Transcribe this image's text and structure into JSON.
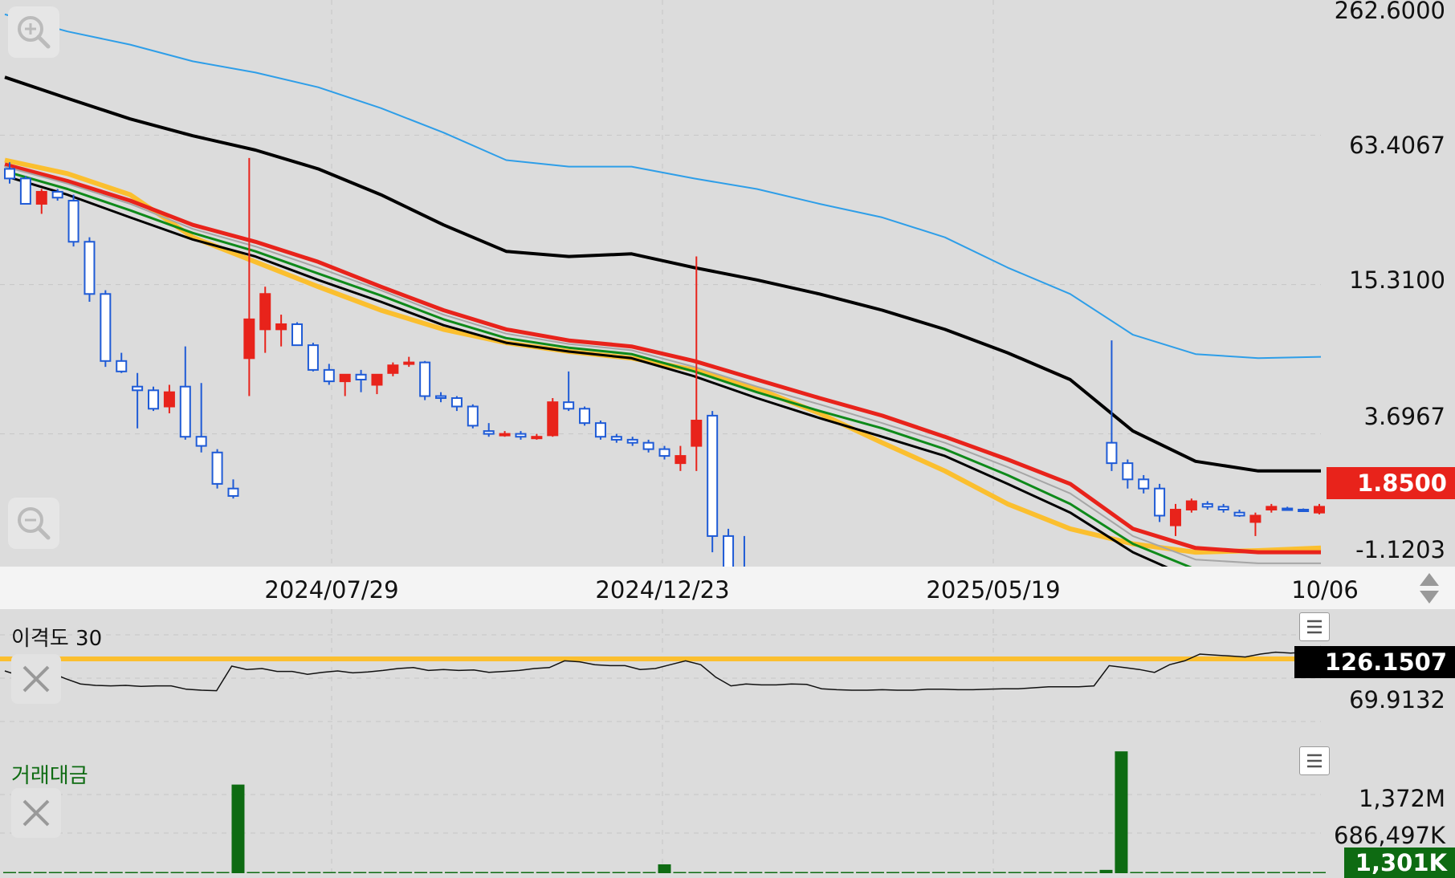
{
  "chart_data": [
    {
      "type": "candlestick",
      "scale": "log",
      "price_axis_labels": [
        "262.6000",
        "63.4067",
        "15.3100",
        "3.6967",
        "-1.1203"
      ],
      "x_axis_labels": [
        "2024/07/29",
        "2024/12/23",
        "2025/05/19",
        "10/06"
      ],
      "current_price": "1.8500",
      "current_price_color": "#e8231b",
      "up_color": "#e8231b",
      "down_color": "#1f5bd6",
      "candles": [
        {
          "o": 46,
          "h": 49,
          "l": 40,
          "c": 42
        },
        {
          "o": 42,
          "h": 43,
          "l": 33,
          "c": 33
        },
        {
          "o": 33,
          "h": 38,
          "l": 30,
          "c": 37
        },
        {
          "o": 37,
          "h": 38,
          "l": 34,
          "c": 35
        },
        {
          "o": 34,
          "h": 36,
          "l": 22,
          "c": 23
        },
        {
          "o": 23,
          "h": 24,
          "l": 13,
          "c": 14
        },
        {
          "o": 14,
          "h": 14.5,
          "l": 7,
          "c": 7.4
        },
        {
          "o": 7.4,
          "h": 8,
          "l": 6.6,
          "c": 6.7
        },
        {
          "o": 5.8,
          "h": 6.6,
          "l": 3.9,
          "c": 5.6
        },
        {
          "o": 5.6,
          "h": 5.8,
          "l": 4.6,
          "c": 4.7
        },
        {
          "o": 4.8,
          "h": 5.9,
          "l": 4.5,
          "c": 5.5
        },
        {
          "o": 5.8,
          "h": 8.5,
          "l": 3.5,
          "c": 3.6
        },
        {
          "o": 3.6,
          "h": 6.0,
          "l": 3.1,
          "c": 3.3
        },
        {
          "o": 3.1,
          "h": 3.2,
          "l": 2.2,
          "c": 2.3
        },
        {
          "o": 2.2,
          "h": 2.4,
          "l": 2.0,
          "c": 2.05
        },
        {
          "o": 7.6,
          "h": 51,
          "l": 5.3,
          "c": 11
        },
        {
          "o": 10,
          "h": 15,
          "l": 8,
          "c": 14
        },
        {
          "o": 10,
          "h": 11.5,
          "l": 8.5,
          "c": 10.5
        },
        {
          "o": 10.5,
          "h": 10.7,
          "l": 8.6,
          "c": 8.6
        },
        {
          "o": 8.6,
          "h": 8.8,
          "l": 6.7,
          "c": 6.8
        },
        {
          "o": 6.8,
          "h": 7.2,
          "l": 5.9,
          "c": 6.1
        },
        {
          "o": 6.1,
          "h": 6.3,
          "l": 5.3,
          "c": 6.5
        },
        {
          "o": 6.5,
          "h": 6.8,
          "l": 5.5,
          "c": 6.2
        },
        {
          "o": 5.9,
          "h": 6.2,
          "l": 5.4,
          "c": 6.5
        },
        {
          "o": 6.6,
          "h": 7.3,
          "l": 6.4,
          "c": 7.1
        },
        {
          "o": 7.2,
          "h": 7.7,
          "l": 7.0,
          "c": 7.3
        },
        {
          "o": 7.3,
          "h": 7.4,
          "l": 5.1,
          "c": 5.3
        },
        {
          "o": 5.3,
          "h": 5.5,
          "l": 5.0,
          "c": 5.2
        },
        {
          "o": 5.2,
          "h": 5.3,
          "l": 4.6,
          "c": 4.8
        },
        {
          "o": 4.8,
          "h": 4.9,
          "l": 3.9,
          "c": 4.0
        },
        {
          "o": 3.8,
          "h": 4.1,
          "l": 3.6,
          "c": 3.7
        },
        {
          "o": 3.7,
          "h": 3.8,
          "l": 3.6,
          "c": 3.7
        },
        {
          "o": 3.7,
          "h": 3.8,
          "l": 3.5,
          "c": 3.6
        },
        {
          "o": 3.6,
          "h": 3.7,
          "l": 3.5,
          "c": 3.6
        },
        {
          "o": 3.65,
          "h": 5.2,
          "l": 3.6,
          "c": 5.0
        },
        {
          "o": 5.0,
          "h": 6.7,
          "l": 4.6,
          "c": 4.7
        },
        {
          "o": 4.7,
          "h": 4.8,
          "l": 4.0,
          "c": 4.1
        },
        {
          "o": 4.1,
          "h": 4.2,
          "l": 3.5,
          "c": 3.6
        },
        {
          "o": 3.6,
          "h": 3.7,
          "l": 3.4,
          "c": 3.5
        },
        {
          "o": 3.5,
          "h": 3.6,
          "l": 3.3,
          "c": 3.4
        },
        {
          "o": 3.4,
          "h": 3.5,
          "l": 3.1,
          "c": 3.2
        },
        {
          "o": 3.2,
          "h": 3.3,
          "l": 2.9,
          "c": 3.0
        },
        {
          "o": 2.8,
          "h": 3.3,
          "l": 2.6,
          "c": 3.0
        },
        {
          "o": 3.3,
          "h": 20,
          "l": 2.6,
          "c": 4.2
        },
        {
          "o": 4.4,
          "h": 4.6,
          "l": 1.2,
          "c": 1.4
        },
        {
          "o": 1.4,
          "h": 1.5,
          "l": 0.95,
          "c": 1.0
        },
        {
          "o": 1.0,
          "h": 1.4,
          "l": 0.8,
          "c": 0.82
        },
        {
          "o": 0.82,
          "h": 0.9,
          "l": 0.55,
          "c": 0.58
        },
        {
          "o": 0.58,
          "h": 0.6,
          "l": 0.5,
          "c": 0.56
        },
        {
          "o": 0.56,
          "h": 0.6,
          "l": 0.5,
          "c": 0.58
        },
        {
          "o": 0.48,
          "h": 0.52,
          "l": 0.45,
          "c": 0.49
        },
        {
          "o": 0.49,
          "h": 0.5,
          "l": 0.48,
          "c": 0.49
        },
        {
          "o": 0.49,
          "h": 0.51,
          "l": 0.47,
          "c": 0.48
        },
        {
          "o": 0.48,
          "h": 0.5,
          "l": 0.4,
          "c": 0.44
        },
        {
          "o": 0.38,
          "h": 0.44,
          "l": 0.32,
          "c": 0.42
        },
        {
          "o": 0.42,
          "h": 0.43,
          "l": 0.39,
          "c": 0.41
        },
        {
          "o": 0.4,
          "h": 0.42,
          "l": 0.36,
          "c": 0.37
        },
        {
          "o": 0.37,
          "h": 0.38,
          "l": 0.3,
          "c": 0.33
        },
        {
          "o": 0.33,
          "h": 0.34,
          "l": 0.3,
          "c": 0.32
        },
        {
          "o": 0.32,
          "h": 0.34,
          "l": 0.31,
          "c": 0.33
        },
        {
          "o": 0.32,
          "h": 0.34,
          "l": 0.31,
          "c": 0.33
        },
        {
          "o": 0.33,
          "h": 0.38,
          "l": 0.32,
          "c": 0.36
        },
        {
          "o": 0.37,
          "h": 0.39,
          "l": 0.36,
          "c": 0.385
        },
        {
          "o": 0.38,
          "h": 0.385,
          "l": 0.37,
          "c": 0.38
        },
        {
          "o": 0.38,
          "h": 0.38,
          "l": 0.36,
          "c": 0.37
        },
        {
          "o": 0.36,
          "h": 0.37,
          "l": 0.33,
          "c": 0.335
        },
        {
          "o": 0.32,
          "h": 0.33,
          "l": 0.29,
          "c": 0.3
        },
        {
          "o": 0.3,
          "h": 0.305,
          "l": 0.29,
          "c": 0.3
        },
        {
          "o": 0.28,
          "h": 0.33,
          "l": 0.25,
          "c": 0.32
        },
        {
          "o": 3.4,
          "h": 9,
          "l": 2.6,
          "c": 2.8
        },
        {
          "o": 2.8,
          "h": 2.9,
          "l": 2.2,
          "c": 2.4
        },
        {
          "o": 2.4,
          "h": 2.5,
          "l": 2.1,
          "c": 2.2
        },
        {
          "o": 2.2,
          "h": 2.3,
          "l": 1.6,
          "c": 1.7
        },
        {
          "o": 1.55,
          "h": 1.9,
          "l": 1.4,
          "c": 1.8
        },
        {
          "o": 1.8,
          "h": 2.0,
          "l": 1.75,
          "c": 1.95
        },
        {
          "o": 1.9,
          "h": 1.95,
          "l": 1.8,
          "c": 1.85
        },
        {
          "o": 1.85,
          "h": 1.9,
          "l": 1.75,
          "c": 1.8
        },
        {
          "o": 1.75,
          "h": 1.8,
          "l": 1.68,
          "c": 1.7
        },
        {
          "o": 1.6,
          "h": 1.75,
          "l": 1.4,
          "c": 1.7
        },
        {
          "o": 1.8,
          "h": 1.9,
          "l": 1.75,
          "c": 1.85
        },
        {
          "o": 1.82,
          "h": 1.85,
          "l": 1.78,
          "c": 1.8
        },
        {
          "o": 1.8,
          "h": 1.82,
          "l": 1.76,
          "c": 1.78
        },
        {
          "o": 1.75,
          "h": 1.9,
          "l": 1.72,
          "c": 1.85
        }
      ],
      "lines": [
        {
          "color": "#2e9ee8",
          "width": 2,
          "values": [
            200,
            170,
            150,
            128,
            115,
            100,
            82,
            65,
            50,
            47,
            47,
            42,
            38,
            33,
            29,
            24,
            18,
            14,
            9.5,
            7.9,
            7.6,
            7.7
          ]
        },
        {
          "color": "#000000",
          "width": 4,
          "values": [
            110,
            90,
            74,
            63,
            55,
            46,
            36,
            27,
            21,
            20,
            20.5,
            18,
            16,
            14,
            12,
            10,
            8.0,
            6.2,
            3.8,
            2.85,
            2.6,
            2.6
          ]
        },
        {
          "color": "#fbbf2f",
          "width": 6,
          "values": [
            50,
            44,
            36,
            24,
            19,
            15,
            12,
            10,
            8.8,
            8.1,
            7.6,
            6.8,
            5.7,
            4.5,
            3.4,
            2.6,
            1.9,
            1.5,
            1.3,
            1.2,
            1.22,
            1.25
          ]
        },
        {
          "color": "#e8231b",
          "width": 5,
          "values": [
            48,
            41,
            34,
            27,
            23,
            19,
            15,
            12,
            10,
            9.0,
            8.5,
            7.4,
            6.2,
            5.2,
            4.4,
            3.6,
            2.9,
            2.3,
            1.5,
            1.25,
            1.2,
            1.2
          ]
        },
        {
          "color": "#a6a6a6",
          "width": 2,
          "values": [
            47,
            40,
            33,
            26,
            22,
            18,
            14.5,
            11.5,
            9.6,
            8.7,
            8.2,
            7.0,
            5.8,
            4.9,
            4.1,
            3.4,
            2.7,
            2.1,
            1.4,
            1.12,
            1.08,
            1.08
          ]
        },
        {
          "color": "#0e8a1a",
          "width": 3,
          "values": [
            45,
            38,
            31,
            25,
            21,
            17,
            13.8,
            11,
            9.2,
            8.4,
            7.9,
            6.7,
            5.5,
            4.6,
            3.9,
            3.2,
            2.5,
            1.9,
            1.3,
            1.02,
            0.98,
            0.98
          ]
        },
        {
          "color": "#000000",
          "width": 3,
          "values": [
            43,
            36,
            29,
            23.5,
            20,
            16,
            13,
            10.4,
            8.8,
            8.1,
            7.6,
            6.4,
            5.2,
            4.3,
            3.6,
            3.0,
            2.3,
            1.75,
            1.2,
            0.92,
            0.88,
            0.88
          ]
        }
      ]
    },
    {
      "type": "line",
      "title": "이격도 30",
      "axis_labels": [
        "126.1507",
        "69.9132"
      ],
      "current_value": "126.1507",
      "reference_color": "#fbbf2f",
      "reference_value": 100,
      "values": [
        75,
        65,
        72,
        72,
        59,
        48,
        45,
        44,
        45,
        43,
        44,
        44,
        37,
        35,
        34,
        85,
        78,
        80,
        74,
        74,
        68,
        72,
        75,
        71,
        73,
        76,
        80,
        82,
        76,
        78,
        76,
        77,
        72,
        74,
        76,
        80,
        82,
        96,
        94,
        88,
        86,
        86,
        78,
        80,
        88,
        96,
        88,
        62,
        44,
        48,
        46,
        46,
        48,
        47,
        38,
        36,
        35,
        35,
        36,
        35,
        35,
        37,
        37,
        36,
        36,
        37,
        38,
        38,
        40,
        42,
        42,
        42,
        44,
        86,
        82,
        78,
        72,
        88,
        96,
        110,
        108,
        106,
        104,
        110,
        114,
        112,
        114,
        126
      ]
    },
    {
      "type": "bar",
      "title": "거래대금",
      "axis_labels": [
        "1,372M",
        "686,497K"
      ],
      "current_value": "1,301K",
      "bar_color": "#0e6b12",
      "values": [
        1.3,
        1.3,
        1.3,
        1.3,
        1.3,
        1.3,
        1.3,
        1.3,
        1.3,
        1.3,
        1.3,
        1.3,
        1.3,
        1.3,
        1.3,
        800,
        2,
        1.3,
        1.3,
        1.3,
        1.3,
        1.3,
        1.3,
        1.3,
        1.3,
        1.3,
        1.3,
        1.3,
        1.3,
        1.3,
        1.3,
        1.3,
        1.3,
        1.3,
        1.3,
        1.3,
        1.3,
        1.3,
        1.3,
        1.3,
        1.3,
        1.3,
        1.3,
        80,
        3,
        1.3,
        1.3,
        1.3,
        1.3,
        1.3,
        1.3,
        1.3,
        1.3,
        1.3,
        1.3,
        1.3,
        1.3,
        1.3,
        1.3,
        1.3,
        1.3,
        1.3,
        1.3,
        1.3,
        1.3,
        1.3,
        1.3,
        1.3,
        1.3,
        1.3,
        1.3,
        1.3,
        30,
        1100,
        2,
        1.3,
        1.3,
        1.3,
        1.3,
        1.3,
        1.3,
        1.3,
        1.3,
        1.3,
        1.3,
        1.3,
        1.3
      ]
    }
  ],
  "ui": {
    "zoom_in_icon": "magnifier-plus-icon",
    "zoom_out_icon": "magnifier-minus-icon",
    "menu_icon": "hamburger-icon",
    "close_icon": "x-icon",
    "scroll_icon": "up-down-arrows-icon"
  }
}
